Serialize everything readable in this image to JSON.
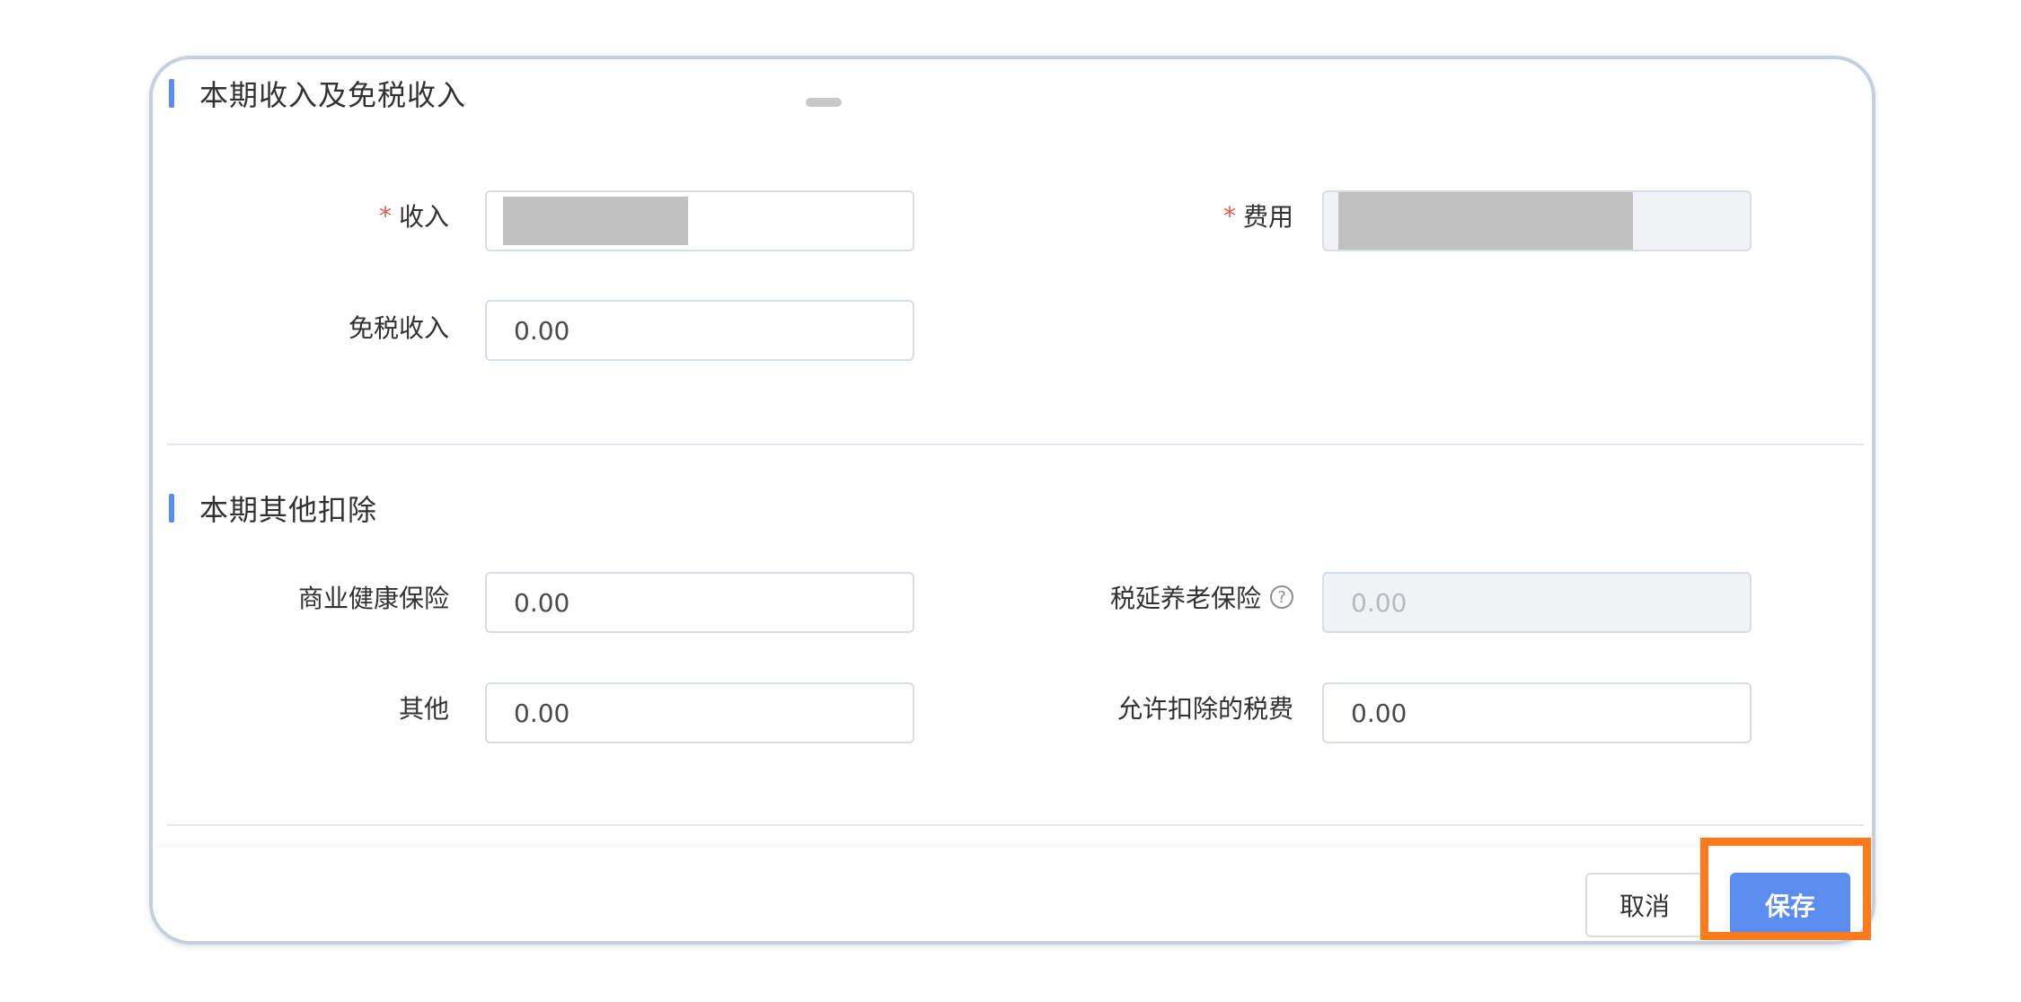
{
  "sections": {
    "income": {
      "title": "本期收入及免税收入",
      "fields": {
        "income_label": "收入",
        "expense_label": "费用",
        "tax_free_income_label": "免税收入",
        "tax_free_income_value": "0.00"
      }
    },
    "other_deductions": {
      "title": "本期其他扣除",
      "fields": {
        "health_insurance_label": "商业健康保险",
        "health_insurance_value": "0.00",
        "tax_deferred_pension_label": "税延养老保险",
        "tax_deferred_pension_value": "0.00",
        "other_label": "其他",
        "other_value": "0.00",
        "allowed_tax_fee_label": "允许扣除的税费",
        "allowed_tax_fee_value": "0.00"
      }
    }
  },
  "required_mark": "*",
  "help_icon_glyph": "?",
  "footer": {
    "cancel_label": "取消",
    "save_label": "保存"
  },
  "colors": {
    "accent": "#5b8def",
    "required": "#e05a4f",
    "highlight": "#ff7a1a"
  }
}
